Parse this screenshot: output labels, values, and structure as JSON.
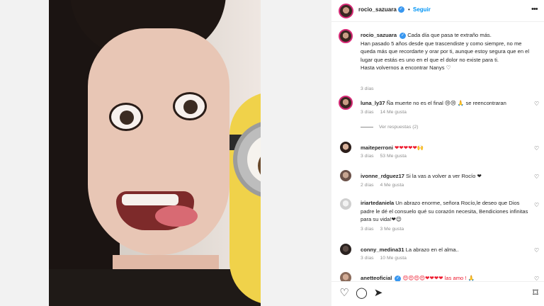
{
  "post": {
    "username": "rocio_sazuara",
    "dot": "•",
    "follow_label": "Seguir",
    "more_label": "•••"
  },
  "caption": {
    "username": "rocio_sazuara",
    "line1": "Cada día que pasa te extraño más.",
    "line2": "Han pasado 5 años desde que trascendiste y como siempre, no me queda más que recordarte y orar por ti, aunque estoy segura que en el lugar que estás es uno en el que el dolor no existe para ti.",
    "line3": "Hasta volvernos a encontrar Nanys ♡",
    "time": "3 días"
  },
  "comments": [
    {
      "username": "luna_ly37",
      "text": "Ña muerte no es el final 😢😢 🙏 se reencontraran",
      "time": "3 días",
      "likes": "14 Me gusta"
    },
    {
      "username": "maiteperroni",
      "text": "❤❤❤❤❤🙌",
      "time": "3 días",
      "likes": "53 Me gusta"
    },
    {
      "username": "ivonne_rdguez17",
      "text": "Si la vas a volver a ver Rocío ❤",
      "time": "2 días",
      "likes": "4 Me gusta"
    },
    {
      "username": "iriartedaniela",
      "text": "Un abrazo enorme, señora Rocío,le deseo que Dios padre le dé el consuelo qué su corazón necesita, Bendiciones infinitas para su vida!❤😌",
      "time": "3 días",
      "likes": "3 Me gusta"
    },
    {
      "username": "conny_medina31",
      "text": "La abrazo en el alma..",
      "time": "3 días",
      "likes": "10 Me gusta"
    },
    {
      "username": "anetteoficial",
      "text": "😍😍😍😍❤❤❤❤ las amo ! 🙏",
      "time": "",
      "likes": ""
    }
  ],
  "view_replies": "Ver respuestas (2)",
  "icons": {
    "like": "heart-icon",
    "comment": "comment-icon",
    "share": "send-icon",
    "save": "bookmark-icon"
  },
  "colors": {
    "follow": "#0095f6",
    "verified": "#3897f0",
    "meta": "#8e8e8e"
  }
}
